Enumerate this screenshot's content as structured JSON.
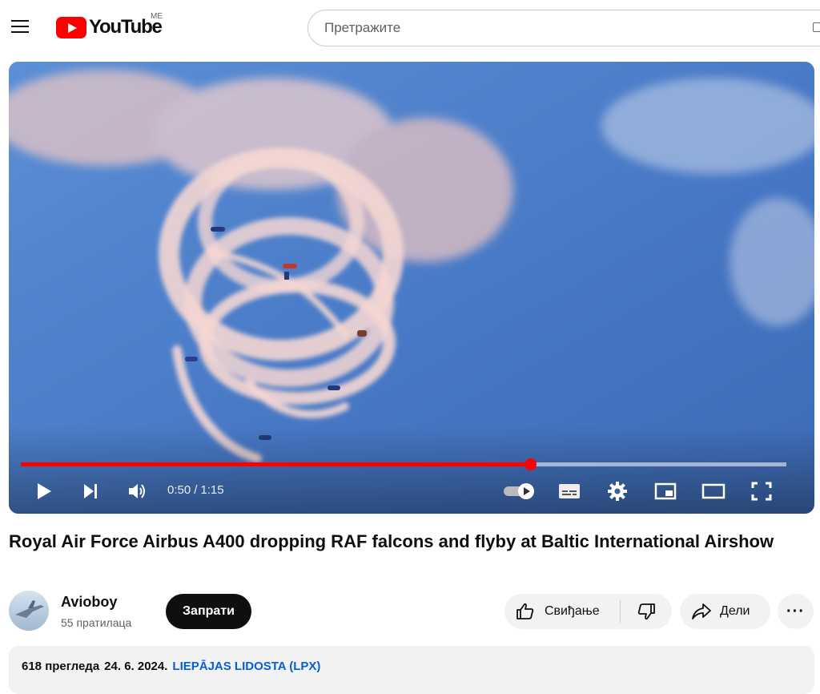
{
  "header": {
    "logo_text": "YouTube",
    "region": "ME",
    "search_placeholder": "Претражите"
  },
  "player": {
    "current_time": "0:50",
    "duration": "1:15",
    "progress": 0.665,
    "autoplay": true
  },
  "video": {
    "title": "Royal Air Force Airbus A400 dropping RAF falcons and flyby at Baltic International Airshow"
  },
  "channel": {
    "name": "Avioboy",
    "subscribers": "55 пратилаца",
    "subscribe_label": "Запрати"
  },
  "actions": {
    "like_label": "Свиђање",
    "share_label": "Дели",
    "more_label": "···"
  },
  "description": {
    "views": "618 прегледа",
    "date": "24. 6. 2024.",
    "location": "LIEPĀJAS LIDOSTA (LPX)"
  },
  "colors": {
    "brand_red": "#ff0000",
    "sky_blue": "#4c7cc6",
    "link_blue": "#065fd4"
  }
}
